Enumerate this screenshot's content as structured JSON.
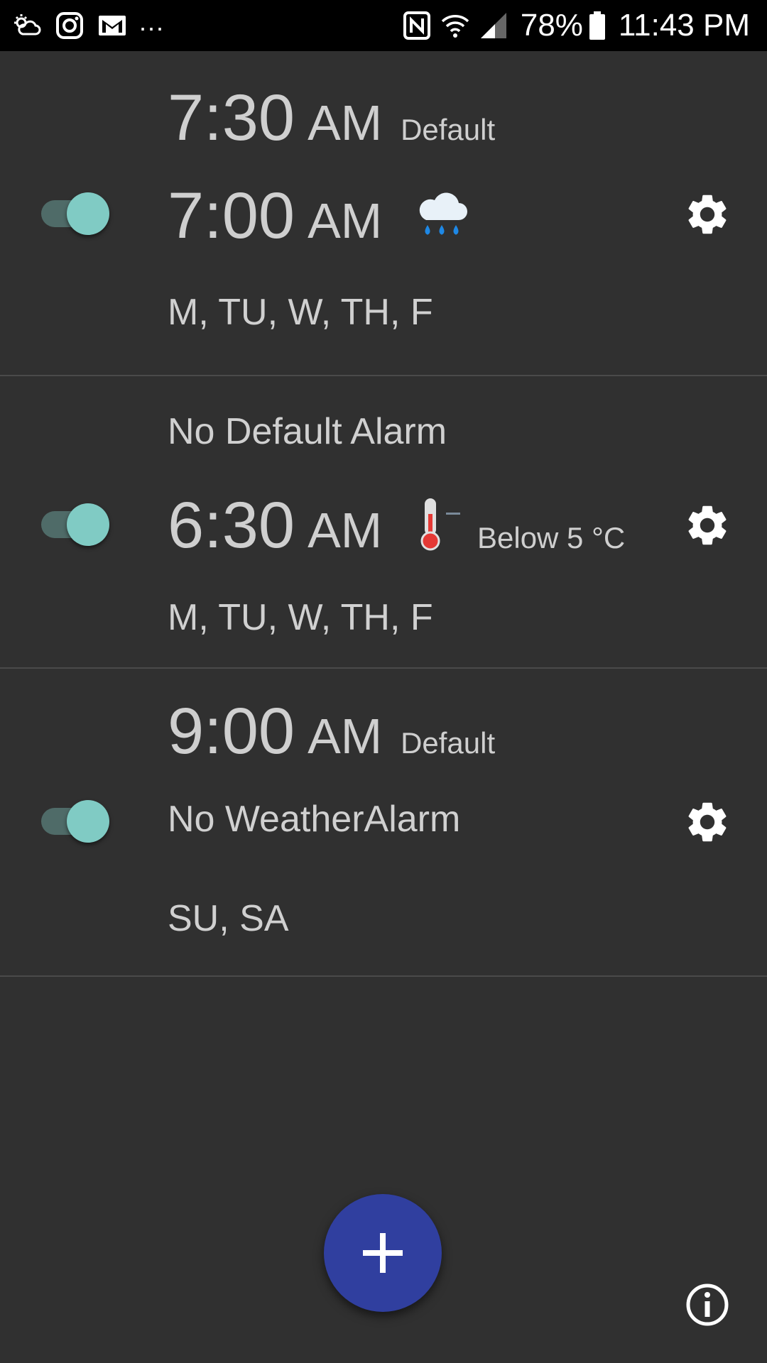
{
  "status_bar": {
    "left_icons": [
      "weather-cloud-icon",
      "instagram-icon",
      "gmail-icon"
    ],
    "more_indicator": "...",
    "right_icons": [
      "nfc-icon",
      "wifi-icon",
      "cell-signal-icon",
      "battery-icon"
    ],
    "battery_percent": "78%",
    "clock": "11:43 PM"
  },
  "alarms": [
    {
      "default_time": "7:30",
      "default_ampm": "AM",
      "default_tag": "Default",
      "enabled": true,
      "weather_time": "7:00",
      "weather_ampm": "AM",
      "weather_condition_icon": "rain-cloud-icon",
      "days": "M, TU, W, TH, F"
    },
    {
      "default_label": "No Default Alarm",
      "enabled": true,
      "weather_time": "6:30",
      "weather_ampm": "AM",
      "weather_condition_icon": "thermometer-icon",
      "weather_condition_text": "Below 5 °C",
      "days": "M, TU, W, TH, F"
    },
    {
      "default_time": "9:00",
      "default_ampm": "AM",
      "default_tag": "Default",
      "enabled": true,
      "weather_label": "No WeatherAlarm",
      "days": "SU, SA"
    }
  ],
  "fab_icon": "plus-icon",
  "info_icon": "info-icon",
  "colors": {
    "background": "#303030",
    "toggle_thumb": "#80cbc4",
    "toggle_track": "#4f6b68",
    "fab": "#303f9f",
    "text": "#cfcfcf"
  }
}
